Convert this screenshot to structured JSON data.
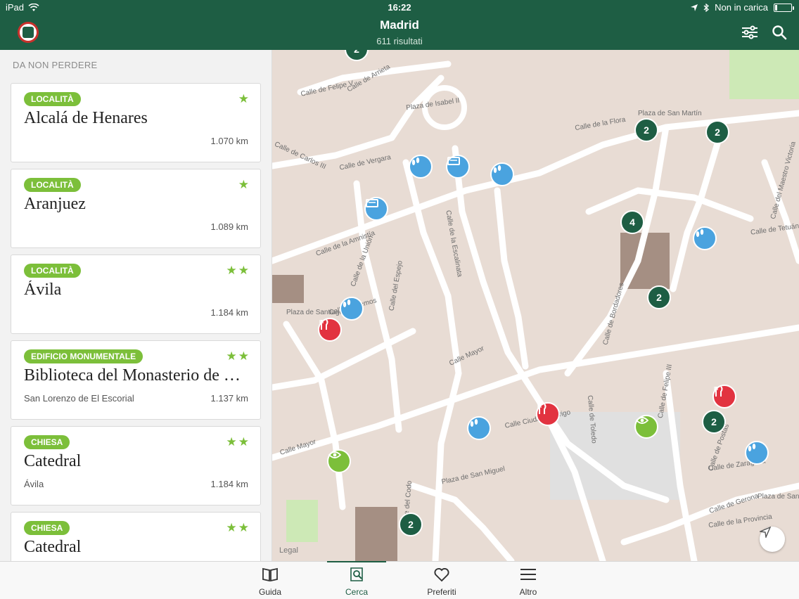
{
  "status_bar": {
    "device": "iPad",
    "time": "16:22",
    "battery_text": "Non in carica",
    "battery_level": 0.12
  },
  "header": {
    "title": "Madrid",
    "subtitle": "611 risultati",
    "icons": [
      "app-logo-icon",
      "filter-icon",
      "search-icon"
    ]
  },
  "sidebar": {
    "section_title": "DA NON PERDERE",
    "cards": [
      {
        "category": "LOCALITÀ",
        "title": "Alcalá de Henares",
        "subtitle": "",
        "distance": "1.070 km",
        "stars": "★"
      },
      {
        "category": "LOCALITÀ",
        "title": "Aranjuez",
        "subtitle": "",
        "distance": "1.089 km",
        "stars": "★"
      },
      {
        "category": "LOCALITÀ",
        "title": "Ávila",
        "subtitle": "",
        "distance": "1.184 km",
        "stars": "★★"
      },
      {
        "category": "EDIFICIO MONUMENTALE",
        "title": "Biblioteca del Monasterio de El Escorial",
        "subtitle": "San Lorenzo de El Escorial",
        "distance": "1.137 km",
        "stars": "★★"
      },
      {
        "category": "CHIESA",
        "title": "Catedral",
        "subtitle": "Ávila",
        "distance": "1.184 km",
        "stars": "★★"
      },
      {
        "category": "CHIESA",
        "title": "Catedral",
        "subtitle": "",
        "distance": "",
        "stars": "★★"
      }
    ]
  },
  "map": {
    "streets": [
      "Calle de Felipe V",
      "Plaza de Isabel II",
      "Calle de Arrieta",
      "Calle de Carlos III",
      "Calle de Vergara",
      "Calle de la Amnistía",
      "Calle de la Unión",
      "Calle del Espejo",
      "Calle de Lemos",
      "Plaza de Santiago",
      "Calle Mayor",
      "Calle Mayor",
      "Calle Ciudad Rodrigo",
      "Calle de Toledo",
      "Calle de Felipe III",
      "Calle de Postas",
      "Plaza de San Miguel",
      "Calle de Zaragoza",
      "Calle de la Flora",
      "Plaza de San Martín",
      "Calle del Maestro Victoria",
      "Calle de Tetuán",
      "Calle de Bordadores",
      "Calle de la Provincia",
      "Plaza de Santa Cruz",
      "Calle de Gerona",
      "Calle del Codo",
      "Calle de la Escalinata"
    ],
    "pins": [
      {
        "kind": "cluster",
        "label": "2"
      },
      {
        "kind": "cluster",
        "label": "2"
      },
      {
        "kind": "cluster",
        "label": "2"
      },
      {
        "kind": "cluster",
        "label": "4"
      },
      {
        "kind": "cluster",
        "label": "2"
      },
      {
        "kind": "cluster",
        "label": "2"
      },
      {
        "kind": "cluster",
        "label": "2"
      },
      {
        "kind": "hotel",
        "label": ""
      },
      {
        "kind": "hotel",
        "label": ""
      },
      {
        "kind": "shoe",
        "label": ""
      },
      {
        "kind": "shoe",
        "label": ""
      },
      {
        "kind": "shoe",
        "label": ""
      },
      {
        "kind": "shoe",
        "label": ""
      },
      {
        "kind": "shoe",
        "label": ""
      },
      {
        "kind": "shoe",
        "label": ""
      },
      {
        "kind": "restaurant",
        "label": ""
      },
      {
        "kind": "restaurant",
        "label": ""
      },
      {
        "kind": "restaurant",
        "label": ""
      },
      {
        "kind": "sight",
        "label": ""
      },
      {
        "kind": "sight",
        "label": ""
      }
    ],
    "legal": "Legal"
  },
  "tabbar": {
    "tabs": [
      {
        "label": "Guida",
        "icon": "book-icon"
      },
      {
        "label": "Cerca",
        "icon": "search-map-icon",
        "active": true
      },
      {
        "label": "Preferiti",
        "icon": "heart-icon"
      },
      {
        "label": "Altro",
        "icon": "menu-icon"
      }
    ]
  },
  "colors": {
    "brand": "#1e5e44",
    "badge": "#7cbf3a",
    "pin_blue": "#4aa3df",
    "pin_red": "#e23340"
  }
}
